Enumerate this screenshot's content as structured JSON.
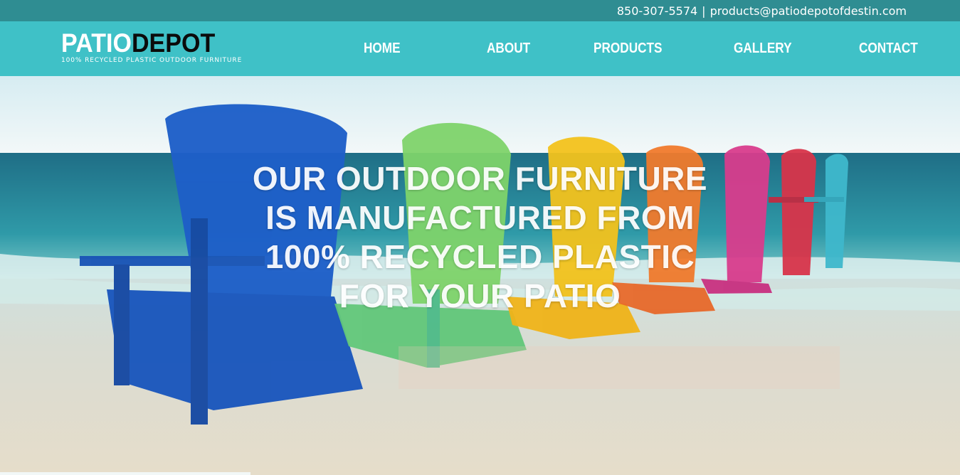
{
  "topbar": {
    "phone": "850-307-5574",
    "separator": "|",
    "email": "products@patiodepotofdestin.com",
    "background": "#2f8d92"
  },
  "header": {
    "background": "#3fc1c7",
    "logo": {
      "word1": "PATIO",
      "word2": "DEPOT",
      "tagline": "100% RECYCLED PLASTIC OUTDOOR FURNITURE"
    },
    "nav": [
      {
        "label": "HOME"
      },
      {
        "label": "ABOUT"
      },
      {
        "label": "PRODUCTS"
      },
      {
        "label": "GALLERY"
      },
      {
        "label": "CONTACT"
      }
    ]
  },
  "hero": {
    "headline": [
      "OUR OUTDOOR FURNITURE",
      "IS MANUFACTURED FROM",
      "100% RECYCLED PLASTIC",
      "FOR YOUR PATIO"
    ],
    "image_description_icon": "beach-adirondack-chairs-image",
    "chair_colors": [
      "#1e5fc8",
      "#7ed36a",
      "#f2c21c",
      "#f07a2c",
      "#d83c8c",
      "#d8344a",
      "#3fb8cc"
    ]
  }
}
